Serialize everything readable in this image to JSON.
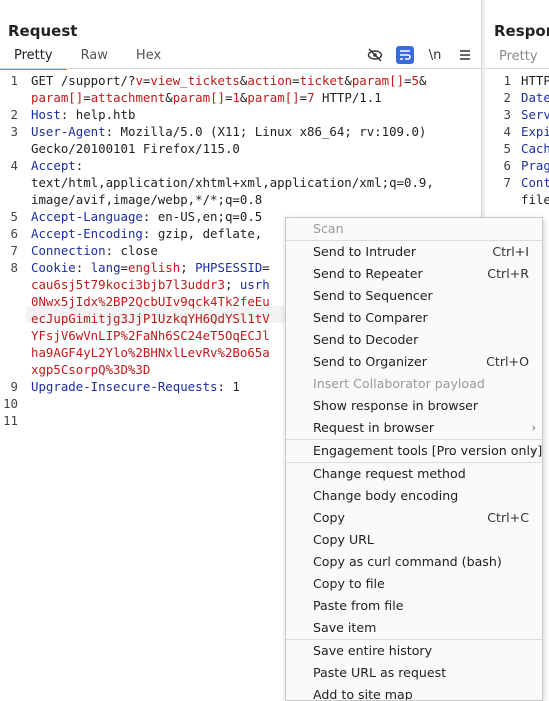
{
  "request": {
    "title": "Request",
    "tabs": [
      "Pretty",
      "Raw",
      "Hex"
    ],
    "toolbar_icons": [
      "eye-slash-icon",
      "wrap-icon",
      "newline-icon",
      "menu-icon"
    ],
    "newline_label": "\\n",
    "lines": [
      {
        "n": "1",
        "segments": [
          {
            "t": "GET /support/?",
            "c": "v"
          },
          {
            "t": "v",
            "c": "ck"
          },
          {
            "t": "=",
            "c": "v"
          },
          {
            "t": "view_tickets",
            "c": "pv"
          },
          {
            "t": "&",
            "c": "v"
          },
          {
            "t": "action",
            "c": "ck"
          },
          {
            "t": "=",
            "c": "v"
          },
          {
            "t": "ticket",
            "c": "pv"
          },
          {
            "t": "&",
            "c": "v"
          },
          {
            "t": "param[]",
            "c": "ck"
          },
          {
            "t": "=",
            "c": "v"
          },
          {
            "t": "5",
            "c": "pv"
          },
          {
            "t": "&",
            "c": "v"
          }
        ]
      },
      {
        "n": "",
        "segments": [
          {
            "t": "param[]",
            "c": "ck"
          },
          {
            "t": "=",
            "c": "v"
          },
          {
            "t": "attachment",
            "c": "pv"
          },
          {
            "t": "&",
            "c": "v"
          },
          {
            "t": "param[]",
            "c": "ck"
          },
          {
            "t": "=",
            "c": "v"
          },
          {
            "t": "1",
            "c": "pv"
          },
          {
            "t": "&",
            "c": "v"
          },
          {
            "t": "param[]",
            "c": "ck"
          },
          {
            "t": "=",
            "c": "v"
          },
          {
            "t": "7",
            "c": "pv"
          },
          {
            "t": " HTTP/1.1",
            "c": "v"
          }
        ]
      },
      {
        "n": "2",
        "segments": [
          {
            "t": "Host",
            "c": "k"
          },
          {
            "t": ": help.htb",
            "c": "v"
          }
        ]
      },
      {
        "n": "3",
        "segments": [
          {
            "t": "User-Agent",
            "c": "k"
          },
          {
            "t": ": Mozilla/5.0 (X11; Linux x86_64; rv:109.0)",
            "c": "v"
          }
        ]
      },
      {
        "n": "",
        "segments": [
          {
            "t": "Gecko/20100101 Firefox/115.0",
            "c": "v"
          }
        ]
      },
      {
        "n": "4",
        "segments": [
          {
            "t": "Accept",
            "c": "k"
          },
          {
            "t": ":",
            "c": "v"
          }
        ]
      },
      {
        "n": "",
        "segments": [
          {
            "t": "text/html,application/xhtml+xml,application/xml;q=0.9,",
            "c": "v"
          }
        ]
      },
      {
        "n": "",
        "segments": [
          {
            "t": "image/avif,image/webp,*/*;q=0.8",
            "c": "v"
          }
        ]
      },
      {
        "n": "5",
        "segments": [
          {
            "t": "Accept-Language",
            "c": "k"
          },
          {
            "t": ": en-US,en;q=0.5",
            "c": "v"
          }
        ]
      },
      {
        "n": "6",
        "segments": [
          {
            "t": "Accept-Encoding",
            "c": "k"
          },
          {
            "t": ": gzip, deflate,",
            "c": "v"
          }
        ]
      },
      {
        "n": "7",
        "segments": [
          {
            "t": "Connection",
            "c": "k"
          },
          {
            "t": ": close",
            "c": "v"
          }
        ]
      },
      {
        "n": "8",
        "segments": [
          {
            "t": "Cookie",
            "c": "k"
          },
          {
            "t": ": ",
            "c": "v"
          },
          {
            "t": "lang",
            "c": "k"
          },
          {
            "t": "=",
            "c": "v"
          },
          {
            "t": "english",
            "c": "pv"
          },
          {
            "t": "; ",
            "c": "v"
          },
          {
            "t": "PHPSESSID",
            "c": "k"
          },
          {
            "t": "=",
            "c": "v"
          }
        ]
      },
      {
        "n": "",
        "segments": [
          {
            "t": "cau6sj5t79koci3bjb7l3uddr3",
            "c": "pv"
          },
          {
            "t": "; ",
            "c": "v"
          },
          {
            "t": "usrh",
            "c": "k"
          }
        ]
      },
      {
        "n": "",
        "segments": [
          {
            "t": "0Nwx5jIdx%2BP2QcbUIv9qck4Tk2feEu",
            "c": "pv"
          }
        ]
      },
      {
        "n": "",
        "segments": [
          {
            "t": "ecJupGimitjg3JjP1UzkqYH6QdYSl1tV",
            "c": "pv"
          }
        ]
      },
      {
        "n": "",
        "segments": [
          {
            "t": "YFsjV6wVnLIP%2FaNh6SC24eT5OqECJl",
            "c": "pv"
          }
        ]
      },
      {
        "n": "",
        "segments": [
          {
            "t": "ha9AGF4yL2Ylo%2BHNxlLevRv%2Bo65a",
            "c": "pv"
          }
        ]
      },
      {
        "n": "",
        "segments": [
          {
            "t": "xgp5CsorpQ%3D%3D",
            "c": "pv"
          }
        ]
      },
      {
        "n": "9",
        "segments": [
          {
            "t": "Upgrade-Insecure-Requests",
            "c": "k"
          },
          {
            "t": ": 1",
            "c": "v"
          }
        ]
      },
      {
        "n": "10",
        "segments": []
      },
      {
        "n": "11",
        "segments": []
      }
    ]
  },
  "response": {
    "title": "Response",
    "tab": "Pretty",
    "lines": [
      {
        "n": "1",
        "t": "HTTP",
        "plain": true
      },
      {
        "n": "2",
        "t": "Date",
        "plain": false
      },
      {
        "n": "3",
        "t": "Serv",
        "plain": false
      },
      {
        "n": "4",
        "t": "Expi",
        "plain": false
      },
      {
        "n": "5",
        "t": "Cach",
        "plain": false
      },
      {
        "n": "6",
        "t": "Prag",
        "plain": false
      },
      {
        "n": "7",
        "t": "Cont",
        "plain": false
      },
      {
        "n": "",
        "t": "file",
        "plain": true
      }
    ]
  },
  "context_menu": {
    "groups": [
      [
        {
          "label": "Scan",
          "shortcut": "",
          "disabled": true,
          "submenu": false
        }
      ],
      [
        {
          "label": "Send to Intruder",
          "shortcut": "Ctrl+I",
          "disabled": false,
          "submenu": false
        },
        {
          "label": "Send to Repeater",
          "shortcut": "Ctrl+R",
          "disabled": false,
          "submenu": false
        },
        {
          "label": "Send to Sequencer",
          "shortcut": "",
          "disabled": false,
          "submenu": false
        },
        {
          "label": "Send to Comparer",
          "shortcut": "",
          "disabled": false,
          "submenu": false
        },
        {
          "label": "Send to Decoder",
          "shortcut": "",
          "disabled": false,
          "submenu": false
        },
        {
          "label": "Send to Organizer",
          "shortcut": "Ctrl+O",
          "disabled": false,
          "submenu": false
        },
        {
          "label": "Insert Collaborator payload",
          "shortcut": "",
          "disabled": true,
          "submenu": false
        },
        {
          "label": "Show response in browser",
          "shortcut": "",
          "disabled": false,
          "submenu": false
        },
        {
          "label": "Request in browser",
          "shortcut": "",
          "disabled": false,
          "submenu": true
        }
      ],
      [
        {
          "label": "Engagement tools [Pro version only]",
          "shortcut": "",
          "disabled": false,
          "submenu": true
        }
      ],
      [
        {
          "label": "Change request method",
          "shortcut": "",
          "disabled": false,
          "submenu": false
        },
        {
          "label": "Change body encoding",
          "shortcut": "",
          "disabled": false,
          "submenu": false
        },
        {
          "label": "Copy",
          "shortcut": "Ctrl+C",
          "disabled": false,
          "submenu": false
        },
        {
          "label": "Copy URL",
          "shortcut": "",
          "disabled": false,
          "submenu": false
        },
        {
          "label": "Copy as curl command (bash)",
          "shortcut": "",
          "disabled": false,
          "submenu": false
        },
        {
          "label": "Copy to file",
          "shortcut": "",
          "disabled": false,
          "submenu": false
        },
        {
          "label": "Paste from file",
          "shortcut": "",
          "disabled": false,
          "submenu": false
        },
        {
          "label": "Save item",
          "shortcut": "",
          "disabled": false,
          "submenu": false
        }
      ],
      [
        {
          "label": "Save entire history",
          "shortcut": "",
          "disabled": false,
          "submenu": false
        },
        {
          "label": "Paste URL as request",
          "shortcut": "",
          "disabled": false,
          "submenu": false
        },
        {
          "label": "Add to site map",
          "shortcut": "",
          "disabled": false,
          "submenu": false
        }
      ]
    ]
  }
}
